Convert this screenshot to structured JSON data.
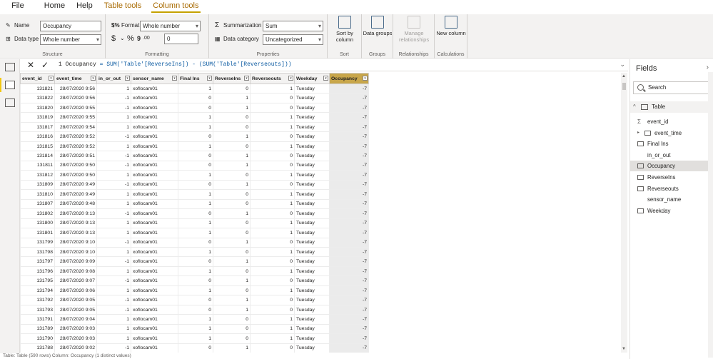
{
  "ribbon_tabs": [
    {
      "label": "File"
    },
    {
      "label": "Home"
    },
    {
      "label": "Help"
    },
    {
      "label": "Table tools"
    },
    {
      "label": "Column tools"
    }
  ],
  "structure": {
    "name_label": "Name",
    "name_value": "Occupancy",
    "datatype_label": "Data type",
    "datatype_value": "Whole number",
    "group_label": "Structure"
  },
  "formatting": {
    "format_label": "Format",
    "format_value": "Whole number",
    "decimal_value": "0",
    "group_label": "Formatting"
  },
  "properties": {
    "summarization_label": "Summarization",
    "summarization_value": "Sum",
    "category_label": "Data category",
    "category_value": "Uncategorized",
    "group_label": "Properties"
  },
  "sort": {
    "label": "Sort by column",
    "group_label": "Sort"
  },
  "groups": {
    "label": "Data groups",
    "group_label": "Groups"
  },
  "relationships": {
    "label": "Manage relationships",
    "group_label": "Relationships"
  },
  "calculations": {
    "label": "New column",
    "group_label": "Calculations"
  },
  "formula": {
    "line": "1",
    "measure": "Occupancy",
    "text": "= SUM('Table'[ReverseIns]) - (SUM('Table'[Reverseouts]))"
  },
  "table": {
    "columns": [
      "event_id",
      "event_time",
      "in_or_out",
      "sensor_name",
      "Final Ins",
      "ReverseIns",
      "Reverseouts",
      "Weekday",
      "Occupancy"
    ],
    "rows": [
      [
        "131821",
        "28/07/2020 9:56",
        "1",
        "xoflocam01",
        "1",
        "0",
        "1",
        "Tuesday",
        "-7"
      ],
      [
        "131822",
        "28/07/2020 9:56",
        "-1",
        "xoflocam01",
        "0",
        "1",
        "0",
        "Tuesday",
        "-7"
      ],
      [
        "131820",
        "28/07/2020 9:55",
        "-1",
        "xoflocam01",
        "0",
        "1",
        "0",
        "Tuesday",
        "-7"
      ],
      [
        "131819",
        "28/07/2020 9:55",
        "1",
        "xoflocam01",
        "1",
        "0",
        "1",
        "Tuesday",
        "-7"
      ],
      [
        "131817",
        "28/07/2020 9:54",
        "1",
        "xoflocam01",
        "1",
        "0",
        "1",
        "Tuesday",
        "-7"
      ],
      [
        "131816",
        "28/07/2020 9:52",
        "-1",
        "xoflocam01",
        "0",
        "1",
        "0",
        "Tuesday",
        "-7"
      ],
      [
        "131815",
        "28/07/2020 9:52",
        "1",
        "xoflocam01",
        "1",
        "0",
        "1",
        "Tuesday",
        "-7"
      ],
      [
        "131814",
        "28/07/2020 9:51",
        "-1",
        "xoflocam01",
        "0",
        "1",
        "0",
        "Tuesday",
        "-7"
      ],
      [
        "131811",
        "28/07/2020 9:50",
        "-1",
        "xoflocam01",
        "0",
        "1",
        "0",
        "Tuesday",
        "-7"
      ],
      [
        "131812",
        "28/07/2020 9:50",
        "1",
        "xoflocam01",
        "1",
        "0",
        "1",
        "Tuesday",
        "-7"
      ],
      [
        "131809",
        "28/07/2020 9:49",
        "-1",
        "xoflocam01",
        "0",
        "1",
        "0",
        "Tuesday",
        "-7"
      ],
      [
        "131810",
        "28/07/2020 9:49",
        "1",
        "xoflocam01",
        "1",
        "0",
        "1",
        "Tuesday",
        "-7"
      ],
      [
        "131807",
        "28/07/2020 9:48",
        "1",
        "xoflocam01",
        "1",
        "0",
        "1",
        "Tuesday",
        "-7"
      ],
      [
        "131802",
        "28/07/2020 9:13",
        "-1",
        "xoflocam01",
        "0",
        "1",
        "0",
        "Tuesday",
        "-7"
      ],
      [
        "131800",
        "28/07/2020 9:13",
        "1",
        "xoflocam01",
        "1",
        "0",
        "1",
        "Tuesday",
        "-7"
      ],
      [
        "131801",
        "28/07/2020 9:13",
        "1",
        "xoflocam01",
        "1",
        "0",
        "1",
        "Tuesday",
        "-7"
      ],
      [
        "131799",
        "28/07/2020 9:10",
        "-1",
        "xoflocam01",
        "0",
        "1",
        "0",
        "Tuesday",
        "-7"
      ],
      [
        "131798",
        "28/07/2020 9:10",
        "1",
        "xoflocam01",
        "1",
        "0",
        "1",
        "Tuesday",
        "-7"
      ],
      [
        "131797",
        "28/07/2020 9:09",
        "-1",
        "xoflocam01",
        "0",
        "1",
        "0",
        "Tuesday",
        "-7"
      ],
      [
        "131796",
        "28/07/2020 9:08",
        "1",
        "xoflocam01",
        "1",
        "0",
        "1",
        "Tuesday",
        "-7"
      ],
      [
        "131795",
        "28/07/2020 9:07",
        "-1",
        "xoflocam01",
        "0",
        "1",
        "0",
        "Tuesday",
        "-7"
      ],
      [
        "131794",
        "28/07/2020 9:06",
        "1",
        "xoflocam01",
        "1",
        "0",
        "1",
        "Tuesday",
        "-7"
      ],
      [
        "131792",
        "28/07/2020 9:05",
        "-1",
        "xoflocam01",
        "0",
        "1",
        "0",
        "Tuesday",
        "-7"
      ],
      [
        "131793",
        "28/07/2020 9:05",
        "-1",
        "xoflocam01",
        "0",
        "1",
        "0",
        "Tuesday",
        "-7"
      ],
      [
        "131791",
        "28/07/2020 9:04",
        "1",
        "xoflocam01",
        "1",
        "0",
        "1",
        "Tuesday",
        "-7"
      ],
      [
        "131789",
        "28/07/2020 9:03",
        "1",
        "xoflocam01",
        "1",
        "0",
        "1",
        "Tuesday",
        "-7"
      ],
      [
        "131790",
        "28/07/2020 9:03",
        "1",
        "xoflocam01",
        "1",
        "0",
        "1",
        "Tuesday",
        "-7"
      ],
      [
        "131788",
        "28/07/2020 9:02",
        "-1",
        "xoflocam01",
        "0",
        "1",
        "0",
        "Tuesday",
        "-7"
      ]
    ]
  },
  "fields_pane": {
    "title": "Fields",
    "search_placeholder": "Search",
    "table_name": "Table",
    "items": [
      {
        "label": "event_id",
        "icon": "sigma-icon"
      },
      {
        "label": "event_time",
        "icon": "calendar-icon"
      },
      {
        "label": "Final Ins",
        "icon": "table-column-icon"
      },
      {
        "label": "in_or_out",
        "icon": ""
      },
      {
        "label": "Occupancy",
        "icon": "table-column-icon"
      },
      {
        "label": "ReverseIns",
        "icon": "table-column-icon"
      },
      {
        "label": "Reverseouts",
        "icon": "table-column-icon"
      },
      {
        "label": "sensor_name",
        "icon": ""
      },
      {
        "label": "Weekday",
        "icon": "table-column-icon"
      }
    ]
  },
  "status_bar": "Table: Table (590 rows) Column: Occupancy (1 distinct values)",
  "colors": {
    "accent": "#f2c811",
    "selected_column": "#c8a64a",
    "context_tab": "#a86a00"
  }
}
